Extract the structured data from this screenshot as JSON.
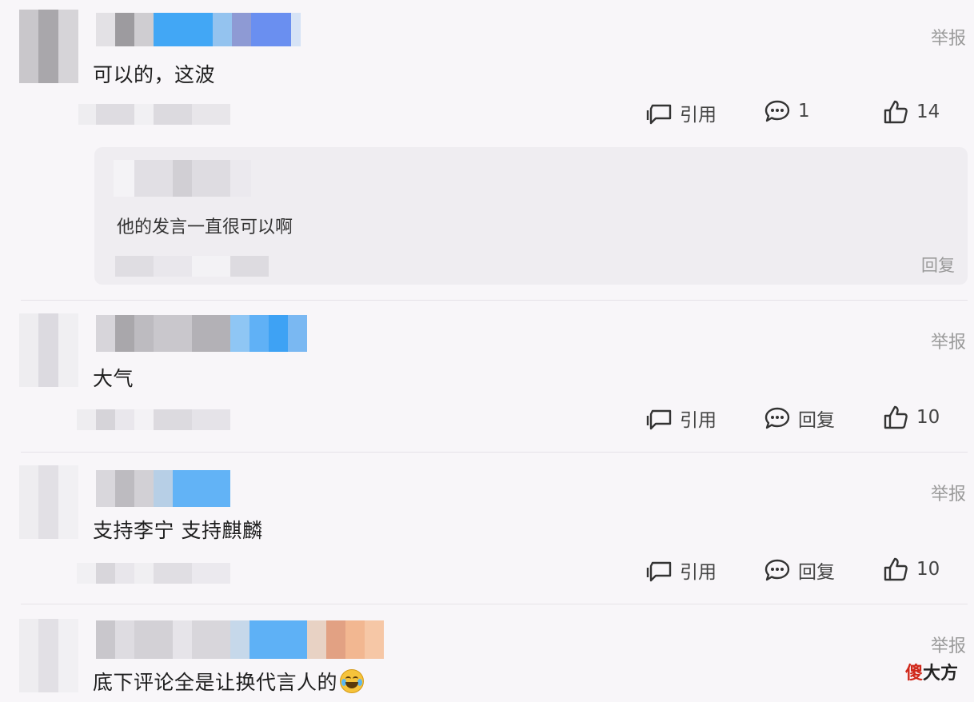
{
  "comments": [
    {
      "text": "可以的，这波",
      "report_label": "举报",
      "quote_label": "引用",
      "reply_count": "1",
      "like_count": "14",
      "replies": [
        {
          "text": "他的发言一直很可以啊",
          "reply_label": "回复"
        }
      ]
    },
    {
      "text": "大气",
      "report_label": "举报",
      "quote_label": "引用",
      "reply_label": "回复",
      "like_count": "10"
    },
    {
      "text": "支持李宁 支持麒麟",
      "report_label": "举报",
      "quote_label": "引用",
      "reply_label": "回复",
      "like_count": "10"
    },
    {
      "text": "底下评论全是让换代言人的",
      "report_label": "举报",
      "trailing_emoji": "laughing-tears-emoji"
    }
  ],
  "watermark": {
    "part1": "傻",
    "part2": "大方"
  },
  "icons": {
    "quote": "quote-icon",
    "comment": "comment-bubble-icon",
    "like": "thumbs-up-icon"
  },
  "colors": {
    "background": "#f8f6f9",
    "reply_box": "#efedf1",
    "muted": "#9a9a9a",
    "watermark_red": "#d0281a"
  }
}
